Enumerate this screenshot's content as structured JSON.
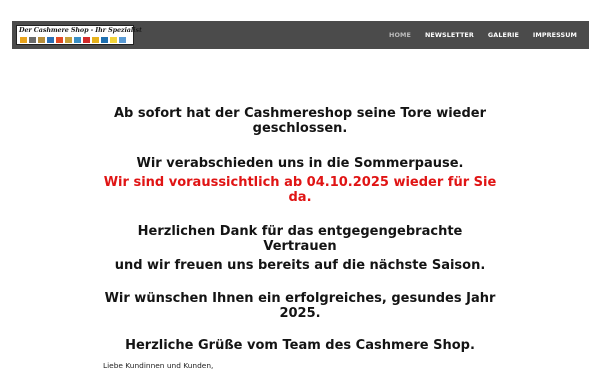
{
  "header": {
    "logo": {
      "text": "Der Cashmere Shop - Ihr Spezialist",
      "swatch_colors": [
        "#e8a31c",
        "#6b6b6b",
        "#b68d3a",
        "#2b6fb5",
        "#e34b26",
        "#c6a13b",
        "#3a8fc4",
        "#d22b2b",
        "#e6b21c",
        "#1e6fb0",
        "#f2d43a",
        "#5a9bd5"
      ]
    },
    "nav": {
      "home": "HOME",
      "newsletter": "NEWSLETTER",
      "galerie": "GALERIE",
      "impressum": "IMPRESSUM"
    }
  },
  "main": {
    "line1": "Ab sofort hat der Cashmereshop seine Tore wieder",
    "line2": "geschlossen.",
    "line3": "Wir verabschieden uns in die Sommerpause.",
    "line4": "Wir sind voraussichtlich ab 04.10.2025 wieder für Sie da.",
    "line5": "Herzlichen Dank für das entgegengebrachte Vertrauen",
    "line6": "und wir freuen uns bereits auf die nächste Saison.",
    "line7": "Wir wünschen Ihnen ein erfolgreiches, gesundes Jahr",
    "line8": "2025.",
    "line9": "Herzliche Grüße vom Team des Cashmere Shop.",
    "salutation": "Liebe Kundinnen und Kunden,"
  },
  "colors": {
    "header_bg": "#4b4b4b",
    "nav_active": "#bdbdbd",
    "highlight_red": "#e01414"
  }
}
